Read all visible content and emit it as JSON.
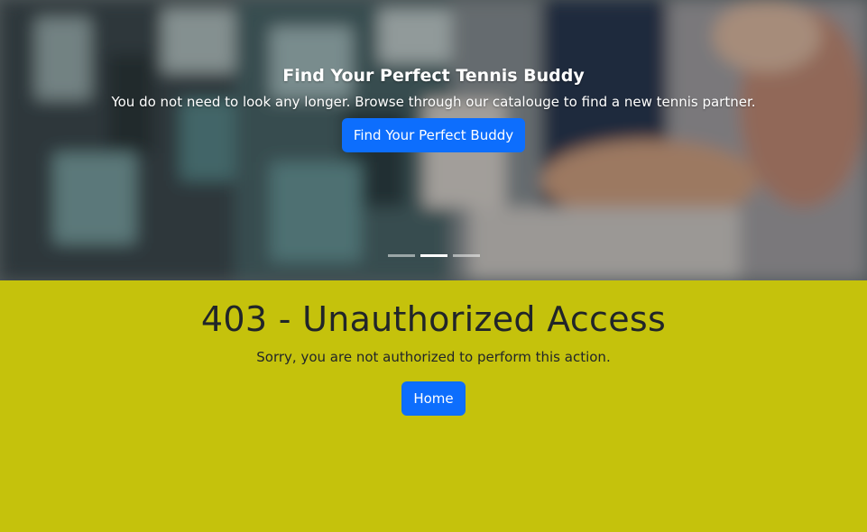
{
  "carousel": {
    "slide_title": "Find Your Perfect Tennis Buddy",
    "slide_text": "You do not need to look any longer. Browse through our catalouge to find a new tennis partner.",
    "slide_button": "Find Your Perfect Buddy",
    "indicator_count": 3,
    "active_indicator": 2
  },
  "error": {
    "title": "403 - Unauthorized Access",
    "message": "Sorry, you are not authorized to perform this action.",
    "home_button": "Home"
  },
  "colors": {
    "accent": "#0d6efd",
    "error_background": "#c5c20c"
  }
}
